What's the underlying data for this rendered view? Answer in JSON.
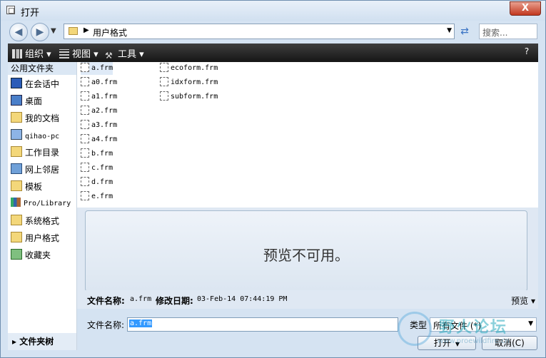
{
  "window": {
    "title": "打开",
    "close_label": "X"
  },
  "nav": {
    "back": "◀",
    "forward": "▶",
    "path": [
      "用户格式"
    ],
    "search_placeholder": "搜索..."
  },
  "toolbar": {
    "organize": "组织",
    "view": "视图",
    "tools": "工具"
  },
  "sidebar": {
    "header": "公用文件夹",
    "items": [
      {
        "label": "在会话中",
        "icon": "monitor-icon"
      },
      {
        "label": "桌面",
        "icon": "desktop-icon"
      },
      {
        "label": "我的文档",
        "icon": "documents-folder-icon"
      },
      {
        "label": "qihao-pc",
        "icon": "computer-icon"
      },
      {
        "label": "工作目录",
        "icon": "work-folder-icon"
      },
      {
        "label": "网上邻居",
        "icon": "network-icon"
      },
      {
        "label": "模板",
        "icon": "folder-icon"
      },
      {
        "label": "Pro/Library",
        "icon": "library-icon"
      },
      {
        "label": "系统格式",
        "icon": "folder-icon"
      },
      {
        "label": "用户格式",
        "icon": "folder-icon"
      },
      {
        "label": "收藏夹",
        "icon": "favorites-icon"
      }
    ],
    "folder_tree": "文件夹树"
  },
  "files": {
    "col1": [
      "a.frm",
      "a0.frm",
      "a1.frm",
      "a2.frm",
      "a3.frm",
      "a4.frm",
      "b.frm",
      "c.frm",
      "d.frm",
      "e.frm"
    ],
    "col2": [
      "ecoform.frm",
      "idxform.frm",
      "subform.frm"
    ],
    "selected": "a.frm"
  },
  "preview": {
    "message": "预览不可用。",
    "toggle": "预览 ▾"
  },
  "details": {
    "name_label": "文件名称:",
    "name_value": "a.frm",
    "date_label": "修改日期:",
    "date_value": "03-Feb-14 07:44:19 PM"
  },
  "bottom": {
    "filename_label": "文件名称:",
    "filename_value": "a.frm",
    "type_label": "类型",
    "type_value": "所有文件 (*)",
    "open_label": "打开",
    "cancel_label": "取消(C)"
  },
  "watermark": {
    "text": "野火论坛",
    "sub": "www.proewildfire.cn"
  }
}
